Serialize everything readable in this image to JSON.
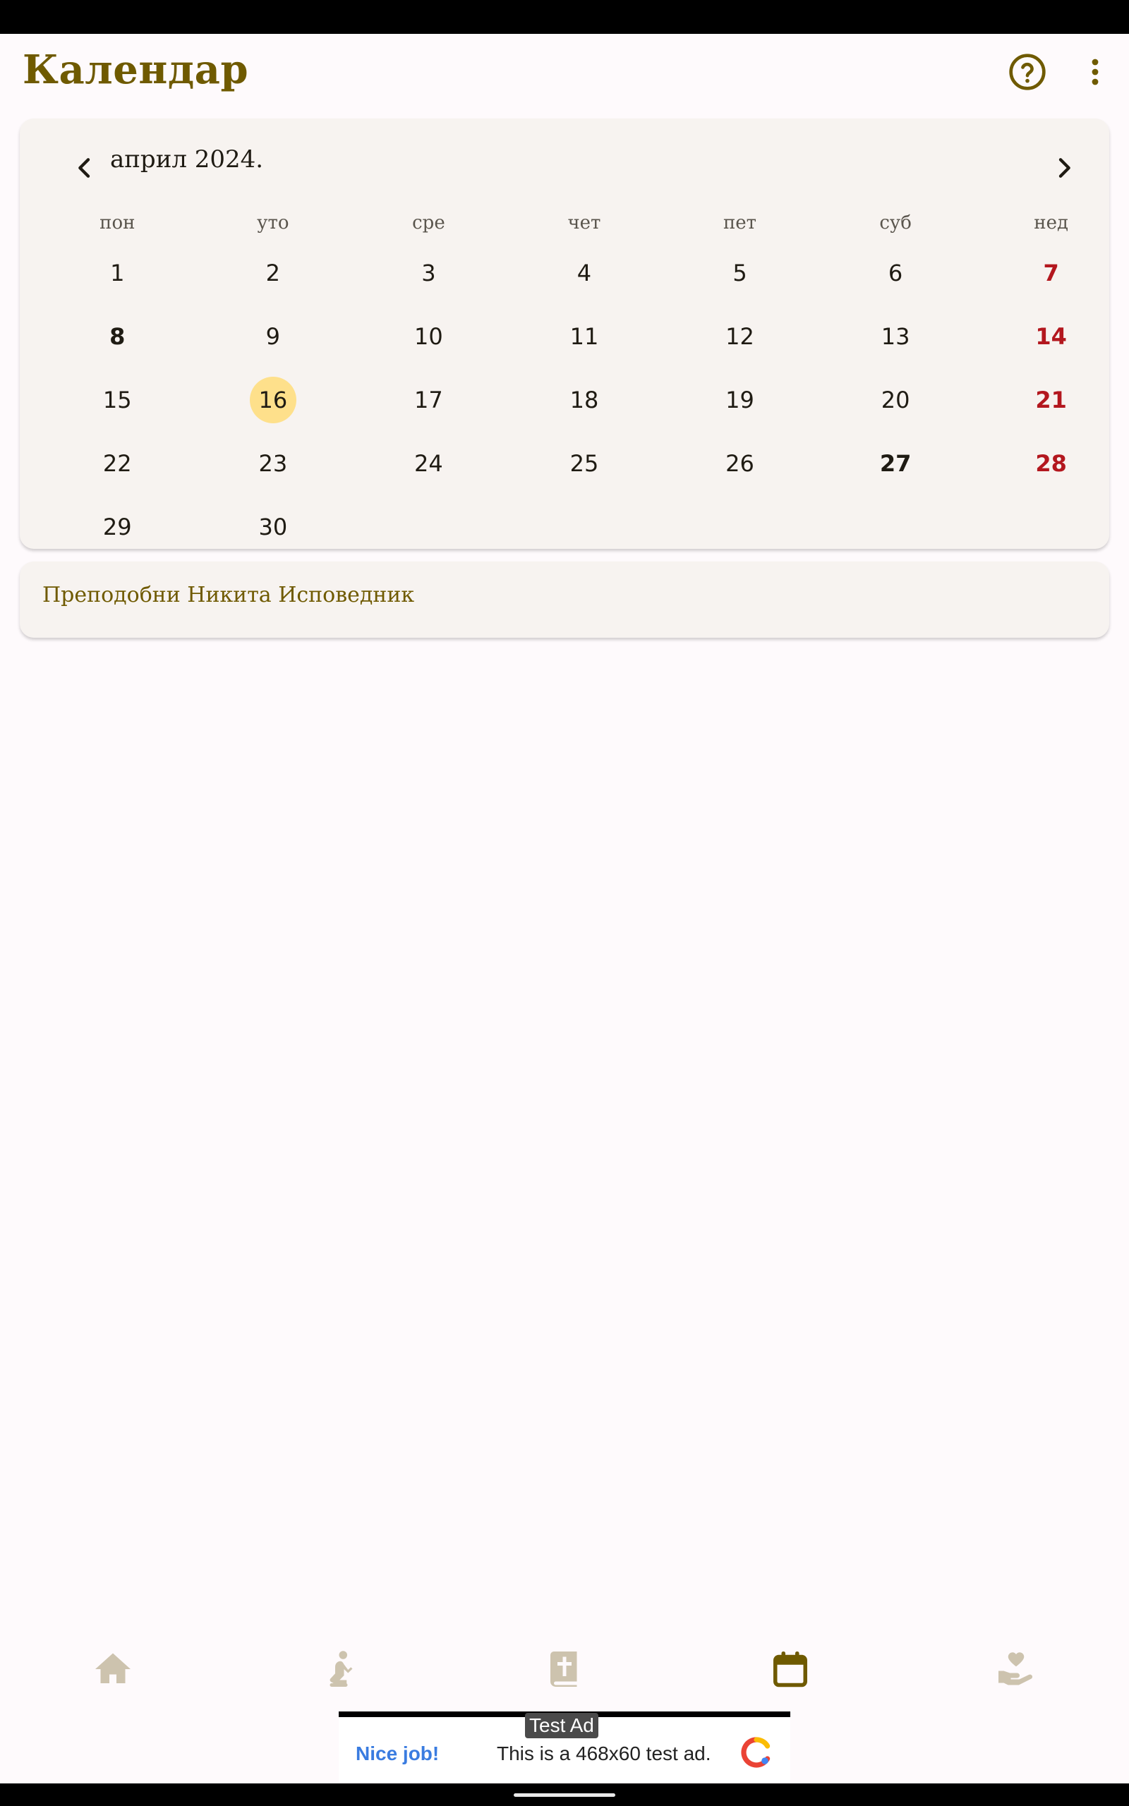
{
  "app": {
    "title": "Календар"
  },
  "colors": {
    "accent": "#6f5a00",
    "sunday": "#b3171e",
    "today_highlight": "#fee08b",
    "card_bg": "#f7f3f0",
    "nav_inactive": "#cdc3ae"
  },
  "header_actions": [
    {
      "icon": "help-circle-icon"
    },
    {
      "icon": "more-vert-icon"
    }
  ],
  "calendar": {
    "month_label": "април 2024.",
    "weekdays": [
      "пон",
      "уто",
      "сре",
      "чет",
      "пет",
      "суб",
      "нед"
    ],
    "days": [
      {
        "n": "1"
      },
      {
        "n": "2"
      },
      {
        "n": "3"
      },
      {
        "n": "4"
      },
      {
        "n": "5"
      },
      {
        "n": "6"
      },
      {
        "n": "7",
        "sunday": true
      },
      {
        "n": "8",
        "bold": true
      },
      {
        "n": "9"
      },
      {
        "n": "10"
      },
      {
        "n": "11"
      },
      {
        "n": "12"
      },
      {
        "n": "13"
      },
      {
        "n": "14",
        "sunday": true
      },
      {
        "n": "15"
      },
      {
        "n": "16",
        "today": true
      },
      {
        "n": "17"
      },
      {
        "n": "18"
      },
      {
        "n": "19"
      },
      {
        "n": "20"
      },
      {
        "n": "21",
        "sunday": true
      },
      {
        "n": "22"
      },
      {
        "n": "23"
      },
      {
        "n": "24"
      },
      {
        "n": "25"
      },
      {
        "n": "26"
      },
      {
        "n": "27",
        "bold": true
      },
      {
        "n": "28",
        "sunday": true
      },
      {
        "n": "29"
      },
      {
        "n": "30"
      }
    ]
  },
  "saint_of_day": "Преподобни Никита Исповедник",
  "bottom_nav": [
    {
      "icon": "home-icon",
      "active": false
    },
    {
      "icon": "praying-person-icon",
      "active": false
    },
    {
      "icon": "bible-icon",
      "active": false
    },
    {
      "icon": "calendar-icon",
      "active": true
    },
    {
      "icon": "hand-heart-icon",
      "active": false
    }
  ],
  "ad": {
    "tag": "Test Ad",
    "headline": "Nice job!",
    "body": "This is a 468x60 test ad."
  }
}
